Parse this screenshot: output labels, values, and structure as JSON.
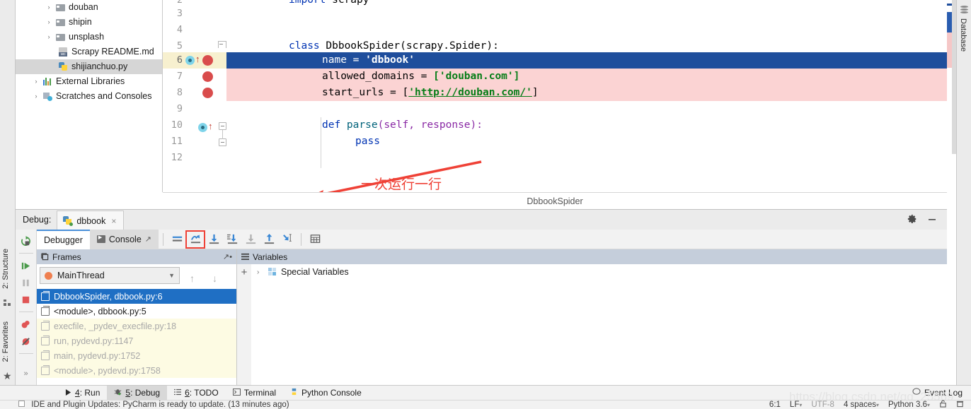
{
  "project_tree": {
    "items": [
      {
        "label": "douban",
        "icon": "folder-icon",
        "arrow": "›",
        "selected": false
      },
      {
        "label": "shipin",
        "icon": "folder-icon",
        "arrow": "›",
        "selected": false
      },
      {
        "label": "unsplash",
        "icon": "folder-icon",
        "arrow": "›",
        "selected": false
      },
      {
        "label": "Scrapy README.md",
        "icon": "markdown-file-icon",
        "arrow": "",
        "selected": false
      },
      {
        "label": "shijianchuo.py",
        "icon": "python-file-icon",
        "arrow": "",
        "selected": true
      },
      {
        "label": "External Libraries",
        "icon": "libraries-icon",
        "arrow": "›",
        "selected": false
      },
      {
        "label": "Scratches and Consoles",
        "icon": "scratches-icon",
        "arrow": "›",
        "selected": false
      }
    ]
  },
  "editor": {
    "breadcrumb": "DbbookSpider",
    "annotation": "一次运行一行",
    "lines": [
      {
        "no": "2",
        "text": "import scrapy"
      },
      {
        "no": "3",
        "text": ""
      },
      {
        "no": "4",
        "text": ""
      },
      {
        "no": "5",
        "text": "class DbbookSpider(scrapy.Spider):"
      },
      {
        "no": "6",
        "text": "    name = 'dbbook'"
      },
      {
        "no": "7",
        "text": "    allowed_domains = ['douban.com']"
      },
      {
        "no": "8",
        "text": "    start_urls = ['http://douban.com/']"
      },
      {
        "no": "9",
        "text": ""
      },
      {
        "no": "10",
        "text": "    def parse(self, response):"
      },
      {
        "no": "11",
        "text": "        pass"
      },
      {
        "no": "12",
        "text": ""
      }
    ],
    "tokens": {
      "import_kw": "import",
      "import_mod": " scrapy",
      "class_kw": "class",
      "class_name": " DbbookSpider",
      "class_bases": "(scrapy.Spider):",
      "name_var": "name",
      "eq": " = ",
      "dbbook_str": "'dbbook'",
      "allowed_var": "allowed_domains",
      "allowed_val": "['douban.com']",
      "start_var": "start_urls",
      "start_open": "[",
      "start_url": "'http://douban.com/'",
      "start_close": "]",
      "def_kw": "def",
      "def_name": " parse",
      "def_params": "(self, response):",
      "pass_kw": "pass"
    }
  },
  "right_strip": {
    "database_label": "Database"
  },
  "left_strip": {
    "structure_label": "2: Structure",
    "favorites_label": "2: Favorites",
    "expand_label": "»"
  },
  "debug_panel": {
    "title": "Debug:",
    "session_tab": "dbbook",
    "close_glyph": "×",
    "settings_icon": "gear-icon",
    "minimize_icon": "minimize-icon",
    "tabs": [
      {
        "label": "Debugger",
        "active": true
      },
      {
        "label": "Console",
        "active": false
      }
    ],
    "toolbar_buttons": [
      {
        "name": "show-execution-point-button",
        "highlighted": false
      },
      {
        "name": "step-over-button",
        "highlighted": true
      },
      {
        "name": "step-into-button",
        "highlighted": false
      },
      {
        "name": "force-step-into-button",
        "highlighted": false
      },
      {
        "name": "step-out-button",
        "highlighted": false
      },
      {
        "name": "run-to-cursor-button",
        "highlighted": false
      },
      {
        "name": "evaluate-expression-button",
        "highlighted": false
      }
    ],
    "side_controls": [
      "rerun-icon",
      "resume-icon",
      "pause-icon",
      "stop-icon",
      "view-breakpoints-icon",
      "mute-breakpoints-icon"
    ]
  },
  "frames": {
    "header": "Frames",
    "thread": "MainThread",
    "list": [
      {
        "label": "DbbookSpider, dbbook.py:6",
        "state": "selected"
      },
      {
        "label": "<module>, dbbook.py:5",
        "state": "plain"
      },
      {
        "label": "execfile, _pydev_execfile.py:18",
        "state": "dimmed"
      },
      {
        "label": "run, pydevd.py:1147",
        "state": "dimmed"
      },
      {
        "label": "main, pydevd.py:1752",
        "state": "dimmed"
      },
      {
        "label": "<module>, pydevd.py:1758",
        "state": "dimmed"
      }
    ],
    "side_buttons": [
      "add-icon",
      "remove-icon",
      "move-up-icon",
      "move-down-icon",
      "copy-icon",
      "inspect-icon"
    ]
  },
  "variables": {
    "header": "Variables",
    "rows": [
      {
        "label": "Special Variables",
        "chevron": "›"
      }
    ]
  },
  "tool_windows": [
    {
      "num": "4",
      "label": ": Run",
      "icon": "run-icon",
      "active": false
    },
    {
      "num": "5",
      "label": ": Debug",
      "icon": "debug-icon",
      "active": true
    },
    {
      "num": "6",
      "label": ": TODO",
      "icon": "todo-icon",
      "active": false
    },
    {
      "num": "",
      "label": "Terminal",
      "icon": "terminal-icon",
      "active": false
    },
    {
      "num": "",
      "label": "Python Console",
      "icon": "python-console-icon",
      "active": false
    }
  ],
  "event_log": "Event Log",
  "status_bar": {
    "message": "IDE and Plugin Updates: PyCharm is ready to update. (13 minutes ago)",
    "caret": "6:1",
    "line_sep": "LF",
    "encoding": "UTF-8",
    "indent": "4 spaces",
    "interpreter": "Python 3.6",
    "lock_icon": "lock-icon",
    "trash_icon": "trash-icon"
  },
  "watermark": "https://blog.csdn.net/qq_25569",
  "colors": {
    "accent_blue": "#1f4e9c",
    "error_bg": "#fbd3d3",
    "highlight_yellow": "#f7f0cf",
    "breakpoint_red": "#d94c4c",
    "annotation_red": "#ef4136",
    "frame_selected": "#1f6fc4",
    "pane_header": "#c5cedb"
  }
}
